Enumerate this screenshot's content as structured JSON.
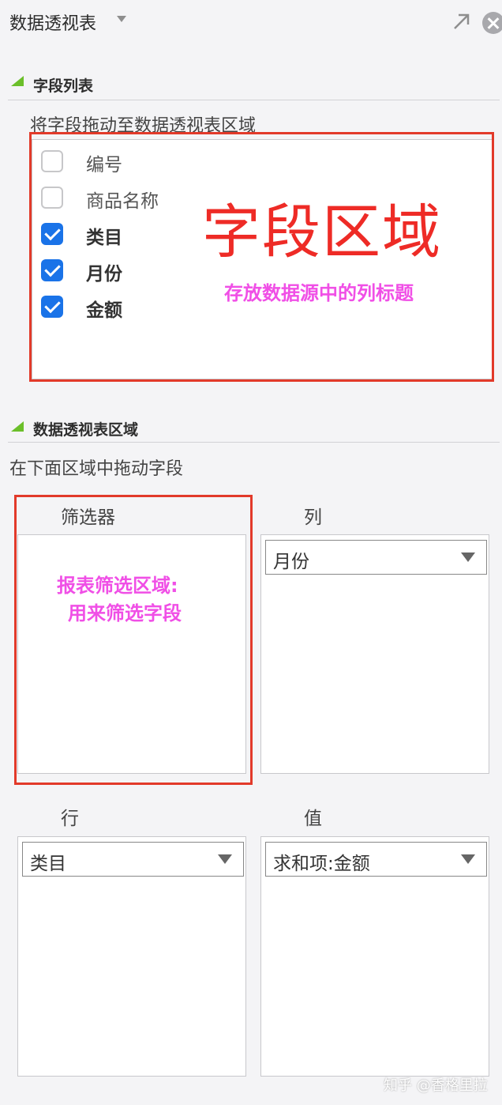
{
  "header": {
    "title": "数据透视表"
  },
  "field_list": {
    "title": "字段列表",
    "hint": "将字段拖动至数据透视表区域",
    "fields": [
      {
        "label": "编号",
        "checked": false
      },
      {
        "label": "商品名称",
        "checked": false
      },
      {
        "label": "类目",
        "checked": true
      },
      {
        "label": "月份",
        "checked": true
      },
      {
        "label": "金额",
        "checked": true
      }
    ],
    "annotation_title": "字段区域",
    "annotation_note": "存放数据源中的列标题"
  },
  "pivot_areas": {
    "title": "数据透视表区域",
    "hint": "在下面区域中拖动字段",
    "filter": {
      "label": "筛选器",
      "note_line1": "报表筛选区域:",
      "note_line2": "用来筛选字段"
    },
    "columns": {
      "label": "列",
      "item": "月份"
    },
    "rows": {
      "label": "行",
      "item": "类目"
    },
    "values": {
      "label": "值",
      "item": "求和项:金额"
    }
  },
  "watermark": "知乎 @香格里拉",
  "colors": {
    "accent": "#1a73e8",
    "annotation_red": "#ee2b26",
    "annotation_pink": "#f04fe6",
    "section_marker": "#6bbf2a"
  }
}
